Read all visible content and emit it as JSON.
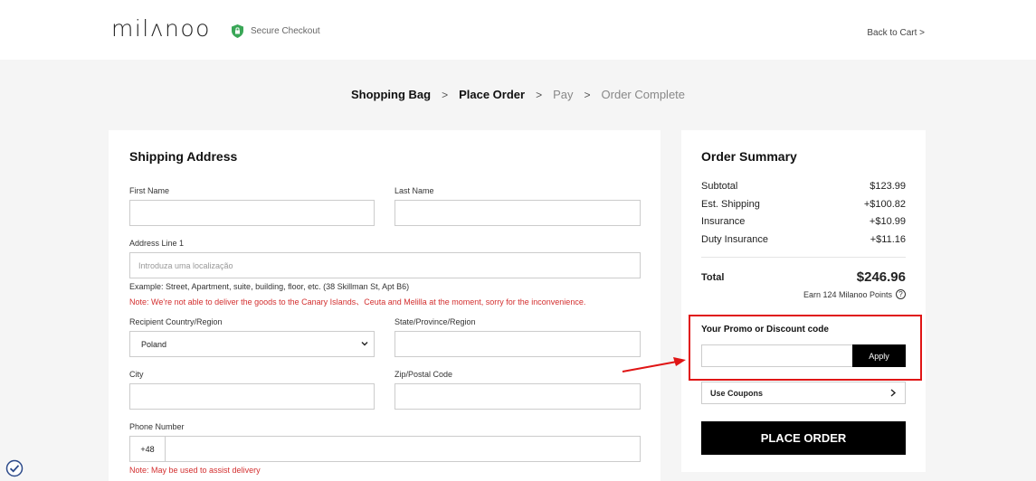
{
  "header": {
    "logo": "milʌnoo",
    "secure_text": "Secure Checkout",
    "back_to_cart": "Back to Cart"
  },
  "steps": [
    {
      "label": "Shopping Bag",
      "state": "done"
    },
    {
      "label": "Place Order",
      "state": "done"
    },
    {
      "label": "Pay",
      "state": "todo"
    },
    {
      "label": "Order Complete",
      "state": "todo"
    }
  ],
  "shipping": {
    "title": "Shipping Address",
    "first_name_label": "First Name",
    "last_name_label": "Last Name",
    "address_label": "Address Line 1",
    "address_placeholder": "Introduza uma localização",
    "address_example": "Example: Street, Apartment, suite, building, floor, etc. (38 Skillman St, Apt B6)",
    "address_note": "Note: We're not able to deliver the goods to the Canary Islands、Ceuta and Melilla at the moment, sorry for the inconvenience.",
    "country_label": "Recipient Country/Region",
    "country_value": "Poland",
    "state_label": "State/Province/Region",
    "city_label": "City",
    "zip_label": "Zip/Postal Code",
    "phone_label": "Phone Number",
    "phone_prefix": "+48",
    "phone_note": "Note: May be used to assist delivery"
  },
  "summary": {
    "title": "Order Summary",
    "rows": [
      {
        "label": "Subtotal",
        "value": "$123.99"
      },
      {
        "label": "Est. Shipping",
        "value": "+$100.82"
      },
      {
        "label": "Insurance",
        "value": "+$10.99"
      },
      {
        "label": "Duty Insurance",
        "value": "+$11.16"
      }
    ],
    "total_label": "Total",
    "total_value": "$246.96",
    "points_text": "Earn 124 Milanoo Points",
    "promo_title": "Your Promo or Discount code",
    "apply_label": "Apply",
    "coupons_label": "Use Coupons",
    "place_order_label": "PLACE ORDER"
  },
  "colors": {
    "accent": "#000000",
    "note_red": "#d32f2f",
    "highlight_red": "#e01515",
    "shield_green": "#3aa757"
  }
}
